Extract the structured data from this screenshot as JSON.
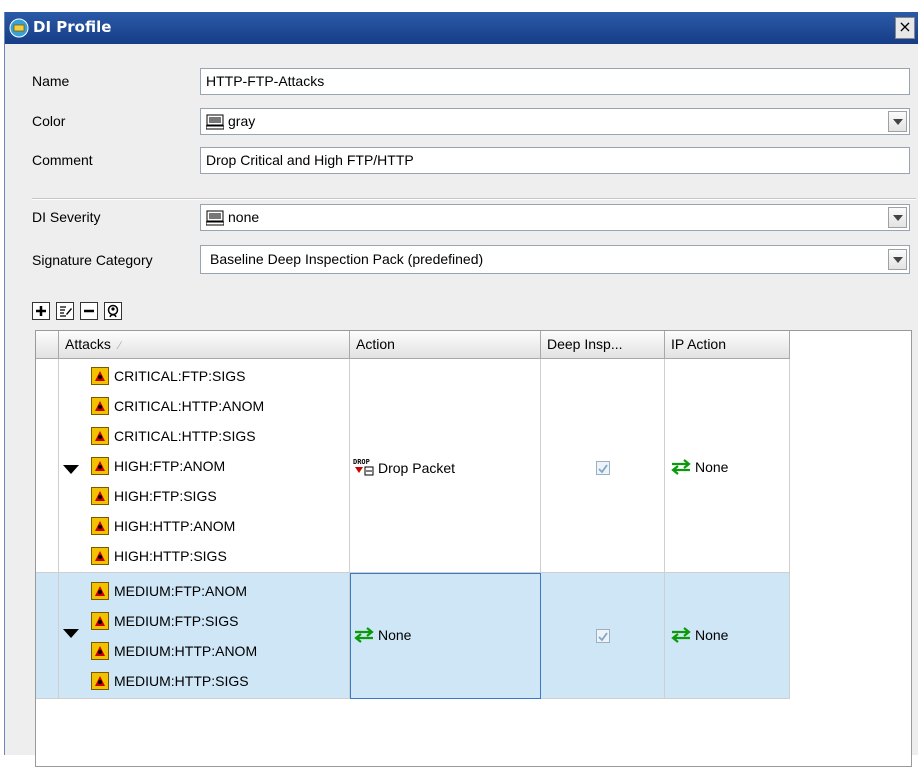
{
  "window": {
    "title": "DI Profile",
    "close_label": "×"
  },
  "form": {
    "name_label": "Name",
    "name_value": "HTTP-FTP-Attacks",
    "color_label": "Color",
    "color_value": "gray",
    "comment_label": "Comment",
    "comment_value": "Drop Critical and High FTP/HTTP",
    "severity_label": "DI Severity",
    "severity_value": "none",
    "category_label": "Signature Category",
    "category_value": "Baseline Deep Inspection Pack  (predefined)"
  },
  "toolbar": {
    "icons": [
      "add-icon",
      "edit-icon",
      "remove-icon",
      "lookup-icon"
    ]
  },
  "table": {
    "headers": {
      "attacks": "Attacks",
      "action": "Action",
      "deep": "Deep Insp...",
      "ip_action": "IP Action"
    },
    "groups": [
      {
        "attacks": [
          "CRITICAL:FTP:SIGS",
          "CRITICAL:HTTP:ANOM",
          "CRITICAL:HTTP:SIGS",
          "HIGH:FTP:ANOM",
          "HIGH:FTP:SIGS",
          "HIGH:HTTP:ANOM",
          "HIGH:HTTP:SIGS"
        ],
        "action": "Drop Packet",
        "action_icon": "drop-packet-icon",
        "deep_inspection": true,
        "ip_action": "None",
        "selected": false
      },
      {
        "attacks": [
          "MEDIUM:FTP:ANOM",
          "MEDIUM:FTP:SIGS",
          "MEDIUM:HTTP:ANOM",
          "MEDIUM:HTTP:SIGS"
        ],
        "action": "None",
        "action_icon": "none-arrows-icon",
        "deep_inspection": true,
        "ip_action": "None",
        "selected": true
      }
    ]
  },
  "colors": {
    "titlebar": "#1f4b99",
    "selection": "#cfe6f7",
    "attack_icon": "#f2c200"
  }
}
